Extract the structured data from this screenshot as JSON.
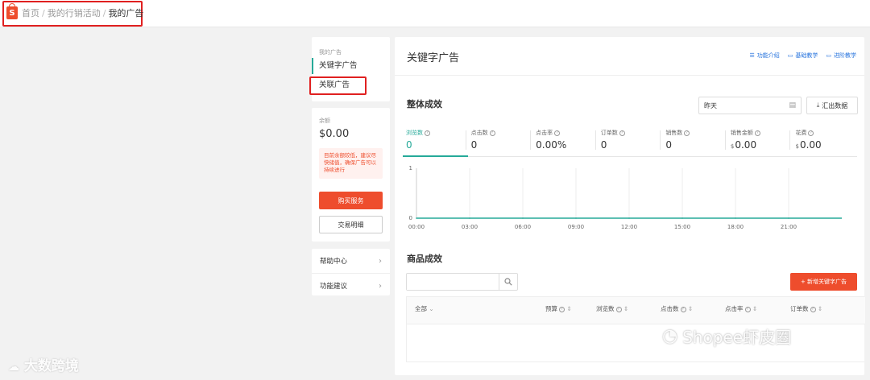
{
  "breadcrumb": {
    "logo_letter": "S",
    "items": [
      "首页",
      "我的行销活动",
      "我的广告"
    ],
    "separator": "/"
  },
  "sidebar": {
    "section_title": "我的广告",
    "items": [
      "关键字广告",
      "关联广告"
    ]
  },
  "balance_card": {
    "label": "余额",
    "amount": "$0.00",
    "warning": "目前余额较低，建议尽快储值，确保广告可以持续进行",
    "buy_label": "购买服务",
    "detail_label": "交易明细"
  },
  "help_menu": {
    "items": [
      "帮助中心",
      "功能建议"
    ]
  },
  "main": {
    "title": "关键字广告",
    "links": [
      {
        "icon": "list-icon",
        "label": "功能介绍"
      },
      {
        "icon": "book-icon",
        "label": "基础教学"
      },
      {
        "icon": "video-icon",
        "label": "进阶教学"
      }
    ],
    "overall_title": "整体成效",
    "date_value": "昨天",
    "export_label": "汇出数据",
    "metrics": [
      {
        "label": "浏览数",
        "value": "0",
        "prefix": ""
      },
      {
        "label": "点击数",
        "value": "0",
        "prefix": ""
      },
      {
        "label": "点击率",
        "value": "0.00%",
        "prefix": ""
      },
      {
        "label": "订单数",
        "value": "0",
        "prefix": ""
      },
      {
        "label": "销售数",
        "value": "0",
        "prefix": ""
      },
      {
        "label": "销售金额",
        "value": "0.00",
        "prefix": "$"
      },
      {
        "label": "花费",
        "value": "0.00",
        "prefix": "$"
      }
    ],
    "product_title": "商品成效",
    "search_placeholder": "",
    "new_ad_label": "+ 新增关键字广告",
    "table_headers": [
      "全部",
      "预算",
      "浏览数",
      "点击数",
      "点击率",
      "订单数"
    ]
  },
  "chart_data": {
    "type": "line",
    "x": [
      "00:00",
      "03:00",
      "06:00",
      "09:00",
      "12:00",
      "15:00",
      "18:00",
      "21:00"
    ],
    "series": [
      {
        "values": [
          0,
          0,
          0,
          0,
          0,
          0,
          0,
          0
        ]
      }
    ],
    "ylim": [
      0,
      1
    ],
    "yticks": [
      "1",
      "0"
    ],
    "grid": true
  },
  "watermarks": {
    "left": "大数跨境",
    "right": "Shopee虾皮圈"
  },
  "colors": {
    "accent": "#26aa99",
    "brand": "#ee4d2d",
    "link": "#2673dd",
    "highlight_box": "#e02020"
  }
}
